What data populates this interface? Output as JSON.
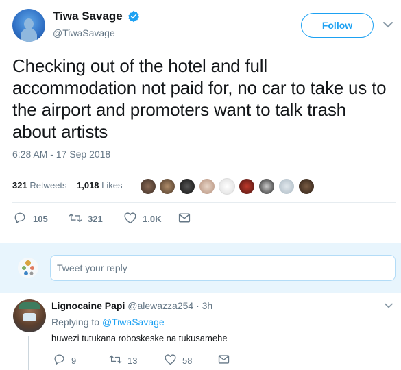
{
  "tweet": {
    "author_name": "Tiwa Savage",
    "author_handle": "@TiwaSavage",
    "follow_label": "Follow",
    "text": "Checking out of the hotel and full accommodation not paid for, no car to take us to the airport and promoters want to talk trash about artists",
    "timestamp": "6:28 AM - 17 Sep 2018",
    "retweets_count": "321",
    "retweets_label": "Retweets",
    "likes_count": "1,018",
    "likes_label": "Likes",
    "actions": {
      "reply_count": "105",
      "retweet_count": "321",
      "like_count": "1.0K"
    }
  },
  "reply_box": {
    "placeholder": "Tweet your reply"
  },
  "reply": {
    "author_name": "Lignocaine Papi",
    "author_handle": "@alewazza254",
    "time": "· 3h",
    "replying_to_prefix": "Replying to",
    "replying_to_handle": "@TiwaSavage",
    "text": "huwezi tutukana roboskeske na tukusamehe",
    "actions": {
      "reply_count": "9",
      "retweet_count": "13",
      "like_count": "58"
    }
  },
  "colors": {
    "accent": "#1da1f2",
    "muted": "#657786",
    "divider": "#e6ecf0"
  }
}
